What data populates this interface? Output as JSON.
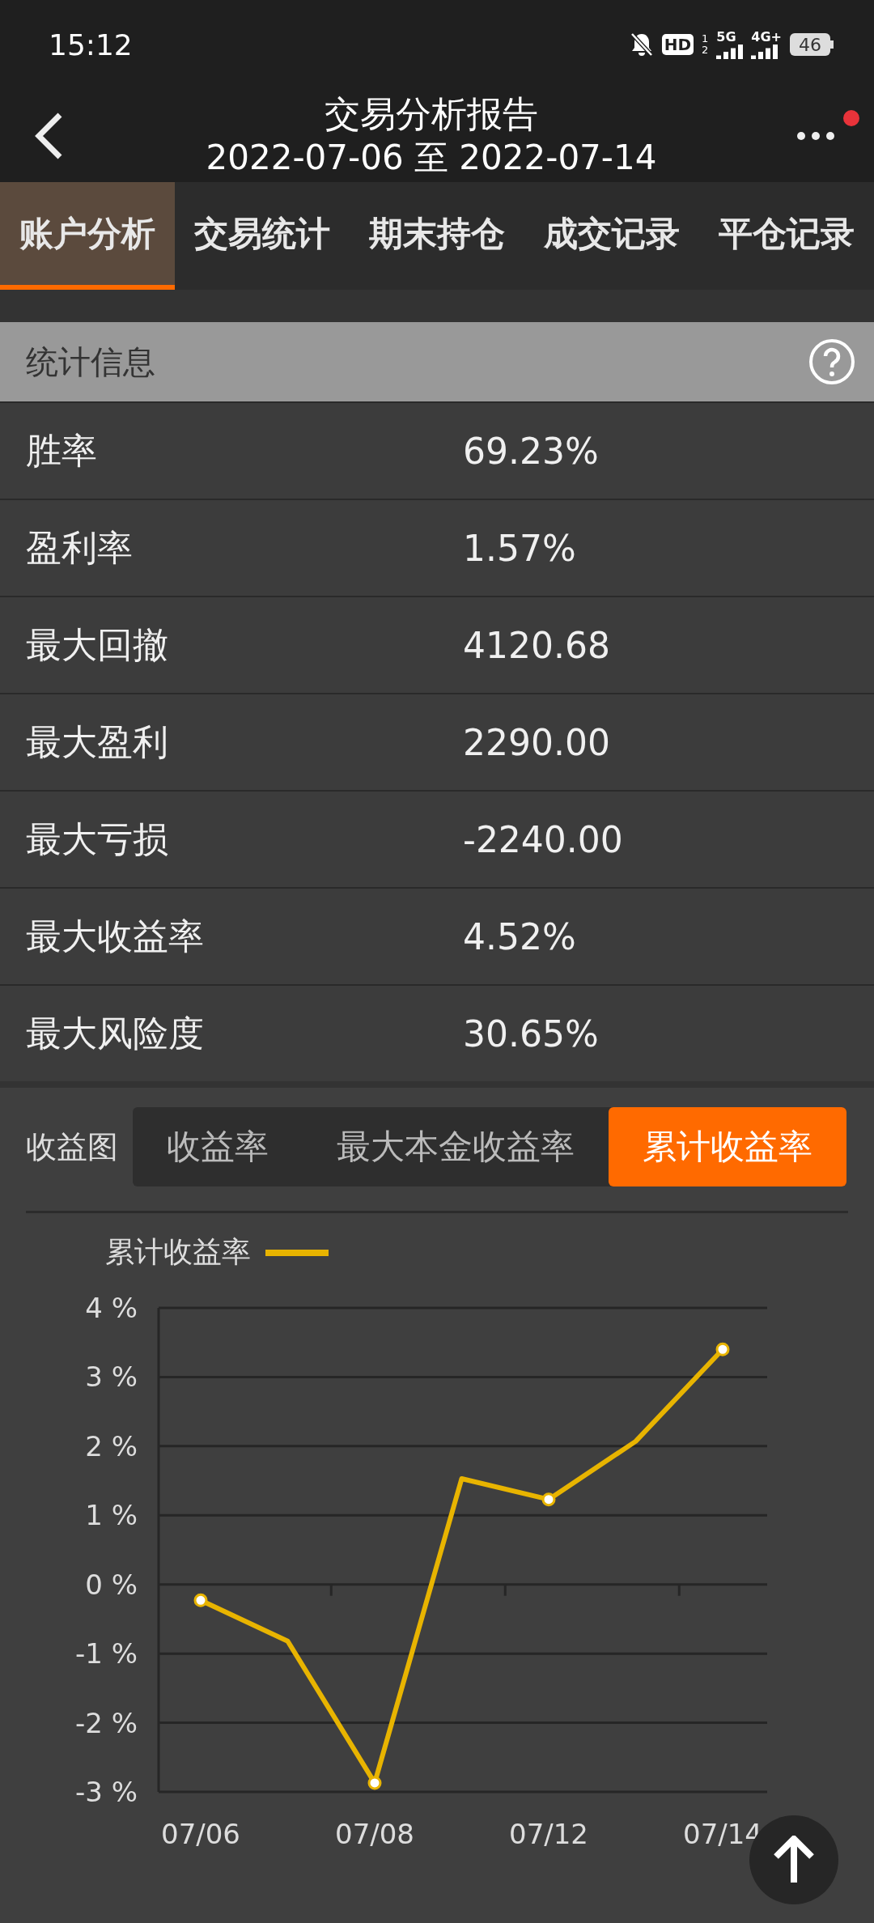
{
  "status_bar": {
    "time": "15:12",
    "hd": "HD",
    "sim_slots": [
      "1",
      "2"
    ],
    "network_1": "5G",
    "network_2": "4G+",
    "battery": "46"
  },
  "header": {
    "title": "交易分析报告",
    "subtitle": "2022-07-06 至 2022-07-14",
    "notification_dot": true
  },
  "tabs": [
    {
      "label": "账户分析",
      "selected": true
    },
    {
      "label": "交易统计",
      "selected": false
    },
    {
      "label": "期末持仓",
      "selected": false
    },
    {
      "label": "成交记录",
      "selected": false
    },
    {
      "label": "平仓记录",
      "selected": false
    }
  ],
  "stats": {
    "title": "统计信息",
    "rows": [
      {
        "label": "胜率",
        "value": "69.23%"
      },
      {
        "label": "盈利率",
        "value": "1.57%"
      },
      {
        "label": "最大回撤",
        "value": "4120.68"
      },
      {
        "label": "最大盈利",
        "value": "2290.00"
      },
      {
        "label": "最大亏损",
        "value": "-2240.00"
      },
      {
        "label": "最大收益率",
        "value": "4.52%"
      },
      {
        "label": "最大风险度",
        "value": "30.65%"
      }
    ]
  },
  "chart_section": {
    "label": "收益图",
    "chart_tabs": [
      {
        "label": "收益率",
        "selected": false
      },
      {
        "label": "最大本金收益率",
        "selected": false
      },
      {
        "label": "累计收益率",
        "selected": true
      }
    ],
    "chart_data": {
      "type": "line",
      "grid": true,
      "categories": [
        "07/06",
        null,
        "07/08",
        null,
        "07/12",
        null,
        "07/14"
      ],
      "series": [
        {
          "name": "累计收益率",
          "color": "#e8b400",
          "values": [
            -0.23,
            -0.82,
            -2.87,
            1.53,
            1.23,
            2.07,
            3.4
          ]
        }
      ],
      "ylim": [
        -3,
        4
      ],
      "yticks": [
        {
          "value": 4,
          "label": "4 %"
        },
        {
          "value": 3,
          "label": "3 %"
        },
        {
          "value": 2,
          "label": "2 %"
        },
        {
          "value": 1,
          "label": "1 %"
        },
        {
          "value": 0,
          "label": "0 %"
        },
        {
          "value": -1,
          "label": "-1 %"
        },
        {
          "value": -2,
          "label": "-2 %"
        },
        {
          "value": -3,
          "label": "-3 %"
        }
      ]
    }
  }
}
